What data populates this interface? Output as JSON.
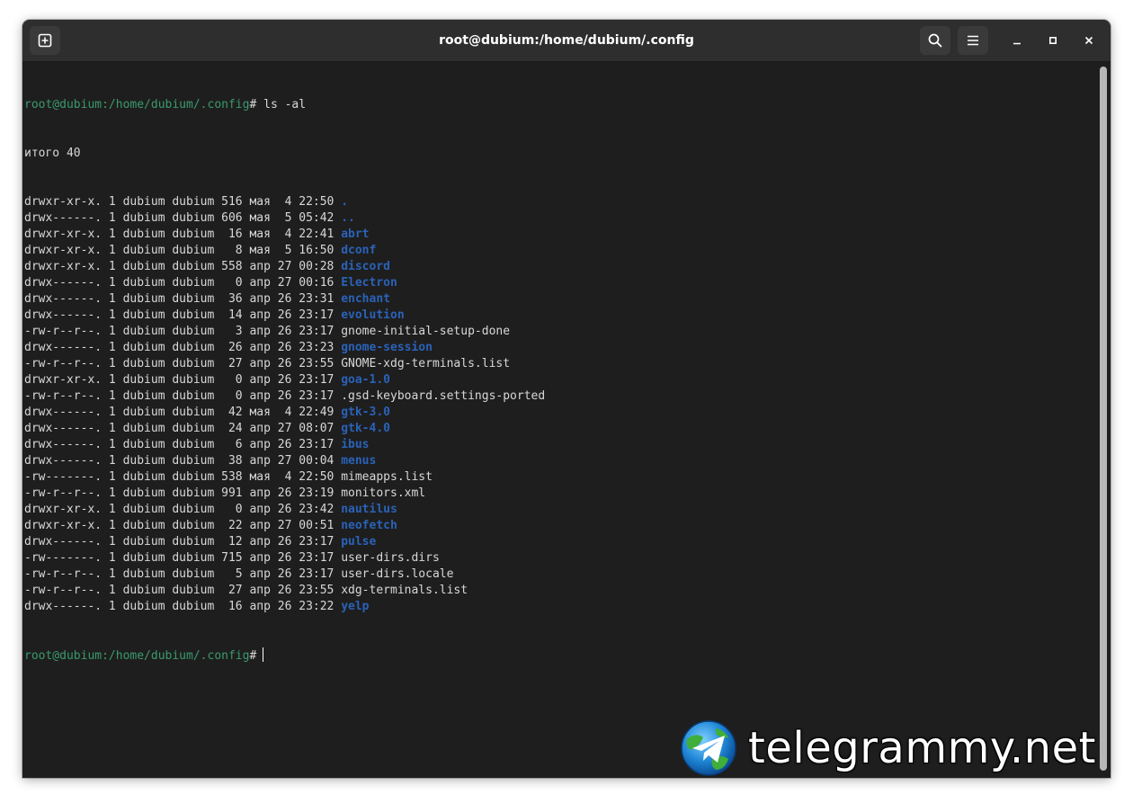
{
  "window": {
    "title": "root@dubium:/home/dubium/.config"
  },
  "icons": {
    "new_tab": "new-tab-icon",
    "search": "search-icon",
    "menu": "hamburger-menu-icon",
    "minimize": "minimize-icon",
    "maximize": "maximize-icon",
    "close": "close-icon"
  },
  "colors": {
    "background": "#1e1e1e",
    "headerbar": "#2e2e2e",
    "prompt": "#3a9a6e",
    "directory": "#2a62b8",
    "text": "#d8d8d8"
  },
  "terminal": {
    "prompt_user": "root@dubium",
    "prompt_path": ":/home/dubium/.config",
    "prompt_symbol": "#",
    "command": " ls -al",
    "total": "итого 40",
    "entries": [
      {
        "meta": "drwxr-xr-x. 1 dubium dubium 516 мая  4 22:50 ",
        "name": ".",
        "is_dir": true
      },
      {
        "meta": "drwx------. 1 dubium dubium 606 мая  5 05:42 ",
        "name": "..",
        "is_dir": true
      },
      {
        "meta": "drwxr-xr-x. 1 dubium dubium  16 мая  4 22:41 ",
        "name": "abrt",
        "is_dir": true
      },
      {
        "meta": "drwxr-xr-x. 1 dubium dubium   8 мая  5 16:50 ",
        "name": "dconf",
        "is_dir": true
      },
      {
        "meta": "drwxr-xr-x. 1 dubium dubium 558 апр 27 00:28 ",
        "name": "discord",
        "is_dir": true
      },
      {
        "meta": "drwx------. 1 dubium dubium   0 апр 27 00:16 ",
        "name": "Electron",
        "is_dir": true
      },
      {
        "meta": "drwx------. 1 dubium dubium  36 апр 26 23:31 ",
        "name": "enchant",
        "is_dir": true
      },
      {
        "meta": "drwx------. 1 dubium dubium  14 апр 26 23:17 ",
        "name": "evolution",
        "is_dir": true
      },
      {
        "meta": "-rw-r--r--. 1 dubium dubium   3 апр 26 23:17 ",
        "name": "gnome-initial-setup-done",
        "is_dir": false
      },
      {
        "meta": "drwx------. 1 dubium dubium  26 апр 26 23:23 ",
        "name": "gnome-session",
        "is_dir": true
      },
      {
        "meta": "-rw-r--r--. 1 dubium dubium  27 апр 26 23:55 ",
        "name": "GNOME-xdg-terminals.list",
        "is_dir": false
      },
      {
        "meta": "drwxr-xr-x. 1 dubium dubium   0 апр 26 23:17 ",
        "name": "goa-1.0",
        "is_dir": true
      },
      {
        "meta": "-rw-r--r--. 1 dubium dubium   0 апр 26 23:17 ",
        "name": ".gsd-keyboard.settings-ported",
        "is_dir": false
      },
      {
        "meta": "drwx------. 1 dubium dubium  42 мая  4 22:49 ",
        "name": "gtk-3.0",
        "is_dir": true
      },
      {
        "meta": "drwx------. 1 dubium dubium  24 апр 27 08:07 ",
        "name": "gtk-4.0",
        "is_dir": true
      },
      {
        "meta": "drwx------. 1 dubium dubium   6 апр 26 23:17 ",
        "name": "ibus",
        "is_dir": true
      },
      {
        "meta": "drwx------. 1 dubium dubium  38 апр 27 00:04 ",
        "name": "menus",
        "is_dir": true
      },
      {
        "meta": "-rw-------. 1 dubium dubium 538 мая  4 22:50 ",
        "name": "mimeapps.list",
        "is_dir": false
      },
      {
        "meta": "-rw-r--r--. 1 dubium dubium 991 апр 26 23:19 ",
        "name": "monitors.xml",
        "is_dir": false
      },
      {
        "meta": "drwxr-xr-x. 1 dubium dubium   0 апр 26 23:42 ",
        "name": "nautilus",
        "is_dir": true
      },
      {
        "meta": "drwxr-xr-x. 1 dubium dubium  22 апр 27 00:51 ",
        "name": "neofetch",
        "is_dir": true
      },
      {
        "meta": "drwx------. 1 dubium dubium  12 апр 26 23:17 ",
        "name": "pulse",
        "is_dir": true
      },
      {
        "meta": "-rw-------. 1 dubium dubium 715 апр 26 23:17 ",
        "name": "user-dirs.dirs",
        "is_dir": false
      },
      {
        "meta": "-rw-r--r--. 1 dubium dubium   5 апр 26 23:17 ",
        "name": "user-dirs.locale",
        "is_dir": false
      },
      {
        "meta": "-rw-r--r--. 1 dubium dubium  27 апр 26 23:55 ",
        "name": "xdg-terminals.list",
        "is_dir": false
      },
      {
        "meta": "drwx------. 1 dubium dubium  16 апр 26 23:22 ",
        "name": "yelp",
        "is_dir": true
      }
    ]
  },
  "watermark": {
    "text": "telegrammy.net"
  }
}
